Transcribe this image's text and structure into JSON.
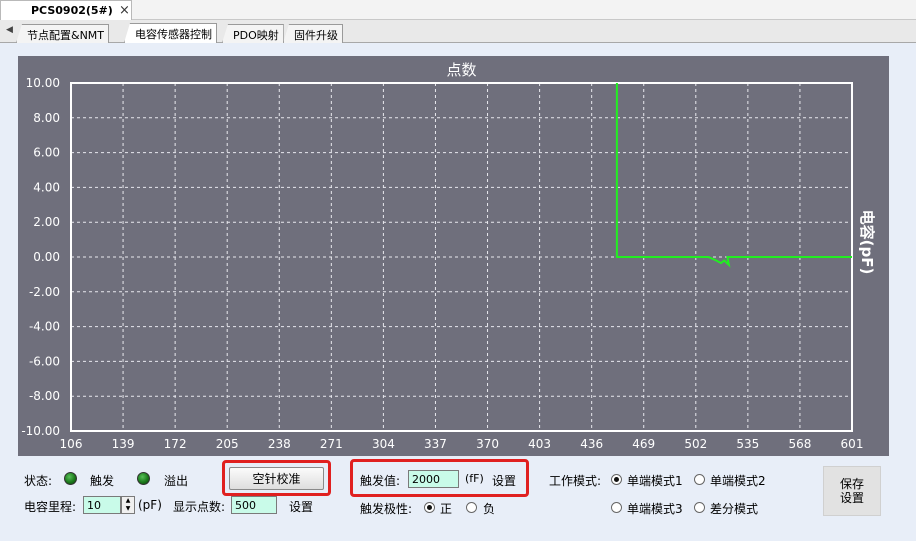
{
  "doc_tab": {
    "label": "PCS0902(5#)",
    "close": "×"
  },
  "tabs": [
    {
      "label": "节点配置&NMT"
    },
    {
      "label": "电容传感器控制"
    },
    {
      "label": "PDO映射"
    },
    {
      "label": "固件升级"
    }
  ],
  "chart_data": {
    "type": "line",
    "title": "点数",
    "ylabel": "电容(pF)",
    "xlabel": "",
    "xlim": [
      106,
      601
    ],
    "ylim": [
      -10,
      10
    ],
    "x_ticks": [
      "106",
      "139",
      "172",
      "205",
      "238",
      "271",
      "304",
      "337",
      "370",
      "403",
      "436",
      "469",
      "502",
      "535",
      "568",
      "601"
    ],
    "y_ticks": [
      "10.00",
      "8.00",
      "6.00",
      "4.00",
      "2.00",
      "0.00",
      "-2.00",
      "-4.00",
      "-6.00",
      "-8.00",
      "-10.00"
    ],
    "grid": true,
    "series": [
      {
        "color": "#22ee22",
        "x": [
          452,
          452,
          510,
          515,
          518,
          520,
          523,
          522,
          601
        ],
        "y": [
          10.0,
          0.0,
          0.0,
          -0.2,
          -0.35,
          -0.2,
          -0.45,
          0.0,
          0.0
        ]
      }
    ]
  },
  "status": {
    "label": "状态:",
    "trigger_label": "触发",
    "overflow_label": "溢出",
    "calibrate_button": "空针校准"
  },
  "trigger": {
    "label": "触发值:",
    "value": "2000",
    "unit": "(fF)",
    "set_button": "设置",
    "polarity_label": "触发极性:",
    "positive": "正",
    "negative": "负"
  },
  "range": {
    "label": "电容里程:",
    "value": "10",
    "unit": "(pF)",
    "points_label": "显示点数:",
    "points_value": "500",
    "set_button": "设置"
  },
  "mode": {
    "label": "工作模式:",
    "options": [
      "单端模式1",
      "单端模式2",
      "单端模式3",
      "差分模式"
    ],
    "selected": "单端模式1"
  },
  "save_button": "保存\n设置",
  "colors": {
    "chart_bg": "#6f6f7c",
    "line": "#22ee22",
    "field_bg": "#c9fbe9",
    "highlight": "#e02020"
  }
}
